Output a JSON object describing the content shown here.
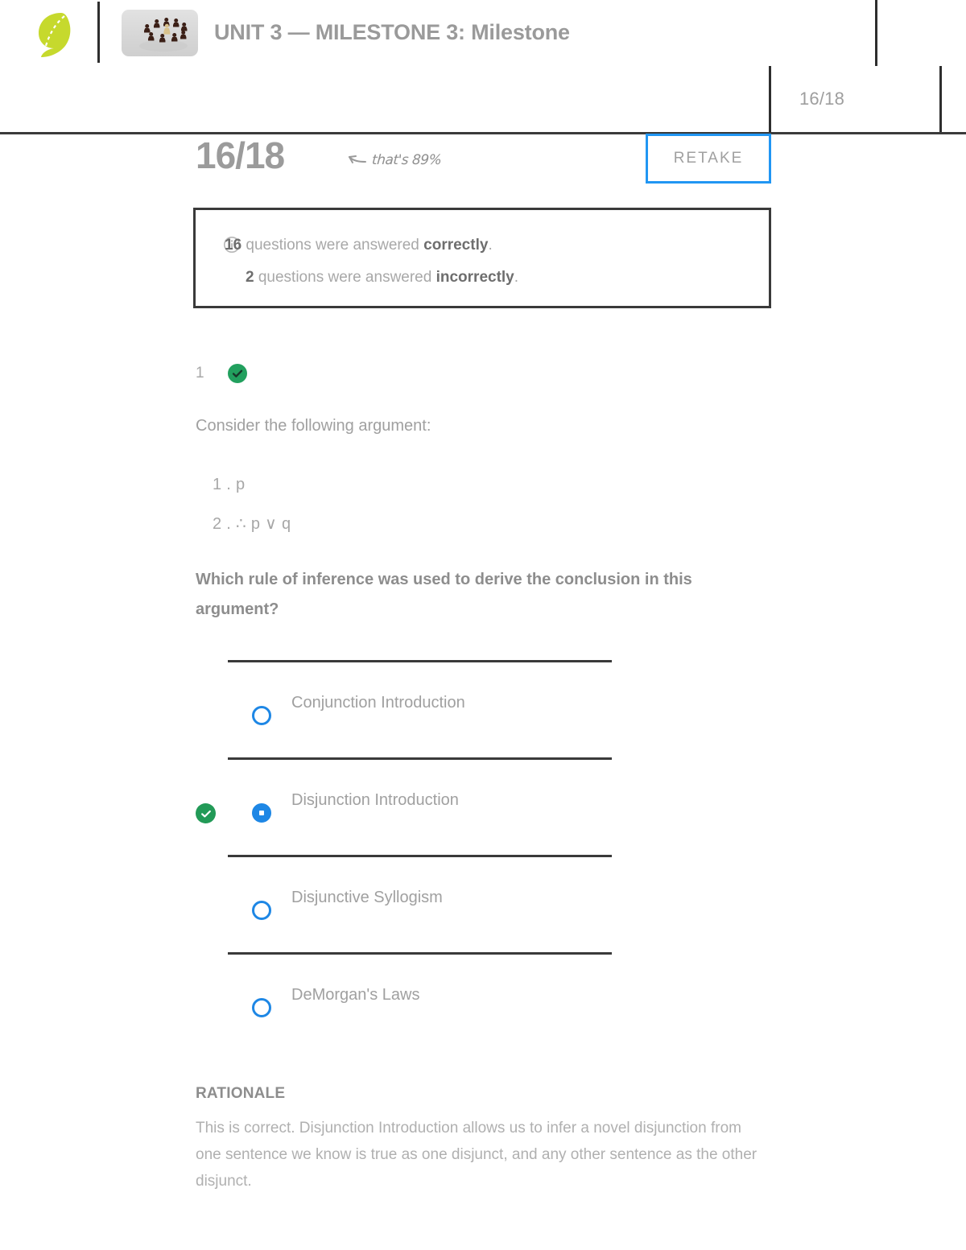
{
  "header": {
    "logo_name": "sophia-logo",
    "thumbnail_name": "chess-pieces-thumbnail",
    "title": "UNIT 3 — MILESTONE 3: Milestone",
    "score_badge": "16/18"
  },
  "score_row": {
    "score": "16/18",
    "annotation": "that's 89%",
    "annotation_arrow": "left-arrow",
    "retake_label": "RETAKE",
    "retake_border_color": "#2196f3"
  },
  "alert": {
    "icon": "info-icon",
    "line1_count": "16",
    "line1_mid": " questions were answered ",
    "line1_emphasis": "correctly",
    "line1_end": ".",
    "line2_count": "2",
    "line2_mid": " questions were answered ",
    "line2_emphasis": "incorrectly",
    "line2_end": "."
  },
  "question": {
    "number": "1",
    "status": "correct",
    "status_color": "#22a05e",
    "intro": "Consider the following argument:",
    "premises": [
      "1 . p",
      "2 . ∴ p ∨ q"
    ],
    "prompt": "Which rule of inference was used to derive the conclusion in this argument?",
    "options": [
      {
        "label": "Conjunction Introduction",
        "selected": false,
        "correct": false
      },
      {
        "label": "Disjunction Introduction",
        "selected": true,
        "correct": true
      },
      {
        "label": "Disjunctive Syllogism",
        "selected": false,
        "correct": false
      },
      {
        "label": "DeMorgan's Laws",
        "selected": false,
        "correct": false
      }
    ],
    "radio_color": "#1e87e5",
    "correct_mark_color": "#229a57"
  },
  "rationale": {
    "title": "RATIONALE",
    "body": "This is correct. Disjunction Introduction allows us to infer a novel disjunction from one sentence we know is true as one disjunct, and any other sentence as the other disjunct."
  }
}
